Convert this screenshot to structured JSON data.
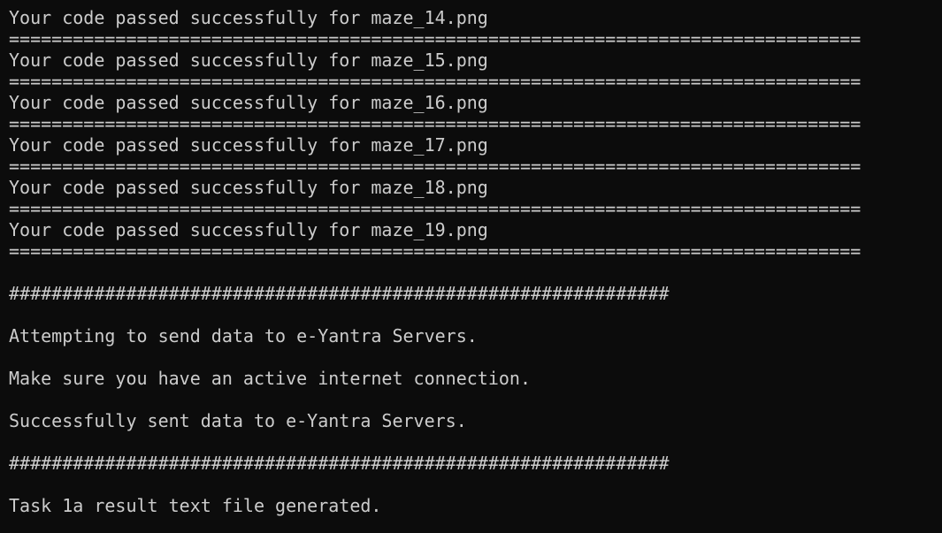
{
  "terminal": {
    "lines": [
      "================================================================================",
      "Your code passed successfully for maze_14.png",
      "================================================================================",
      "Your code passed successfully for maze_15.png",
      "================================================================================",
      "Your code passed successfully for maze_16.png",
      "================================================================================",
      "Your code passed successfully for maze_17.png",
      "================================================================================",
      "Your code passed successfully for maze_18.png",
      "================================================================================",
      "Your code passed successfully for maze_19.png",
      "================================================================================",
      "",
      "##############################################################",
      "",
      "Attempting to send data to e-Yantra Servers.",
      "",
      "Make sure you have an active internet connection.",
      "",
      "Successfully sent data to e-Yantra Servers.",
      "",
      "##############################################################",
      "",
      "Task 1a result text file generated."
    ]
  },
  "colors": {
    "background": "#0c0c0c",
    "text": "#cccccc"
  }
}
